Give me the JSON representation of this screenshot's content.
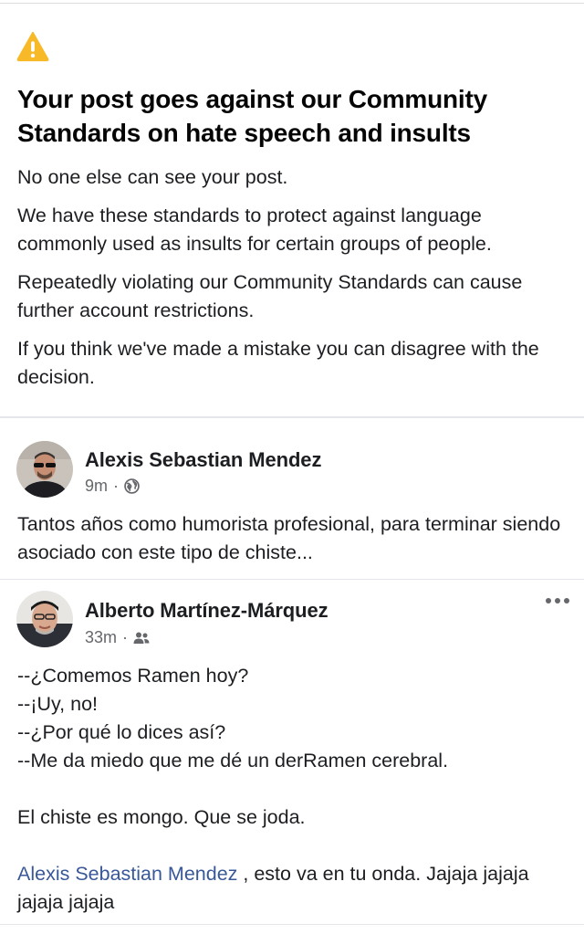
{
  "notice": {
    "icon": "warning-icon",
    "icon_color": "#f7b928",
    "title": "Your post goes against our Community Standards on hate speech and insults",
    "paragraphs": [
      "No one else can see your post.",
      "We have these standards to protect against language commonly used as insults for certain groups of people.",
      "Repeatedly violating our Community Standards can cause further account restrictions.",
      "If you think we've made a mistake you can disagree with the decision."
    ]
  },
  "share_post": {
    "author": "Alexis Sebastian Mendez",
    "time": "9m",
    "separator": "·",
    "audience_icon": "globe-icon",
    "text": "Tantos años como humorista profesional, para terminar siendo asociado con este tipo de chiste..."
  },
  "original_post": {
    "author": "Alberto Martínez-Márquez",
    "time": "33m",
    "separator": "·",
    "audience_icon": "friends-icon",
    "more_icon": "more-options-icon",
    "lines": [
      "--¿Comemos Ramen hoy?",
      "--¡Uy, no!",
      "--¿Por qué lo dices así?",
      "--Me da miedo que me dé un derRamen cerebral.",
      "",
      "El chiste es mongo. Que se joda.",
      ""
    ],
    "mention_name": "Alexis Sebastian Mendez",
    "mention_text": " , esto va en tu onda. Jajaja jajaja jajaja jajaja",
    "link_color": "#385898"
  }
}
